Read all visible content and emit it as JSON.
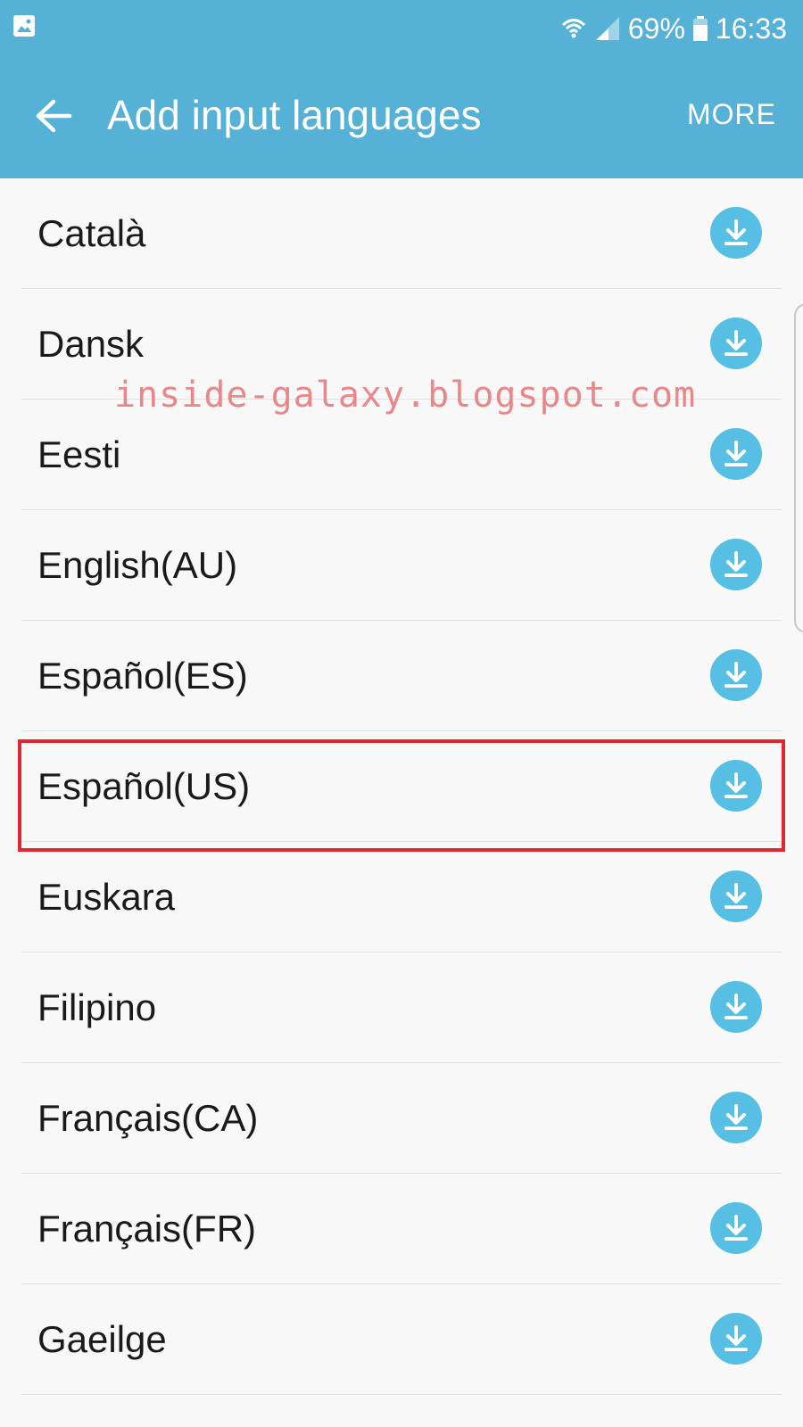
{
  "status_bar": {
    "battery_percent": "69%",
    "time": "16:33",
    "icons": [
      "gallery-icon",
      "wifi-icon",
      "signal-icon",
      "battery-icon"
    ]
  },
  "app_bar": {
    "title": "Add input languages",
    "more_label": "MORE",
    "back_icon": "arrow-left-icon"
  },
  "languages": [
    {
      "label": "Català"
    },
    {
      "label": "Dansk"
    },
    {
      "label": "Eesti"
    },
    {
      "label": "English(AU)"
    },
    {
      "label": "Español(ES)"
    },
    {
      "label": "Español(US)",
      "highlighted": true
    },
    {
      "label": "Euskara"
    },
    {
      "label": "Filipino"
    },
    {
      "label": "Français(CA)"
    },
    {
      "label": "Français(FR)"
    },
    {
      "label": "Gaeilge"
    }
  ],
  "watermark": "inside-galaxy.blogspot.com",
  "colors": {
    "app_bar": "#56b1d6",
    "download_icon": "#56bfe3",
    "highlight_border": "#e0282e",
    "watermark": "#e88888"
  }
}
